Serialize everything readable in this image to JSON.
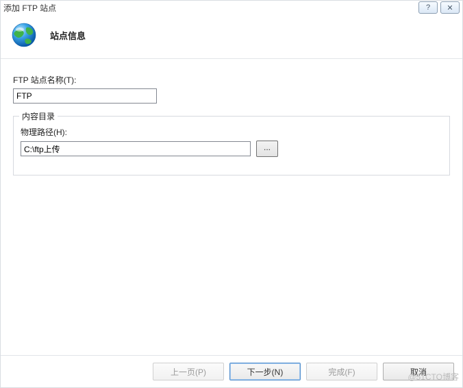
{
  "titlebar": {
    "title": "添加 FTP 站点",
    "help_symbol": "?",
    "close_symbol": "✕"
  },
  "header": {
    "title": "站点信息"
  },
  "form": {
    "site_name_label": "FTP 站点名称(T):",
    "site_name_value": "FTP",
    "content_group_title": "内容目录",
    "physical_path_label": "物理路径(H):",
    "physical_path_value": "C:\\ftp上传",
    "browse_label": "..."
  },
  "footer": {
    "prev": "上一页(P)",
    "next": "下一步(N)",
    "finish": "完成(F)",
    "cancel": "取消"
  },
  "watermark": "@51CTO博客"
}
